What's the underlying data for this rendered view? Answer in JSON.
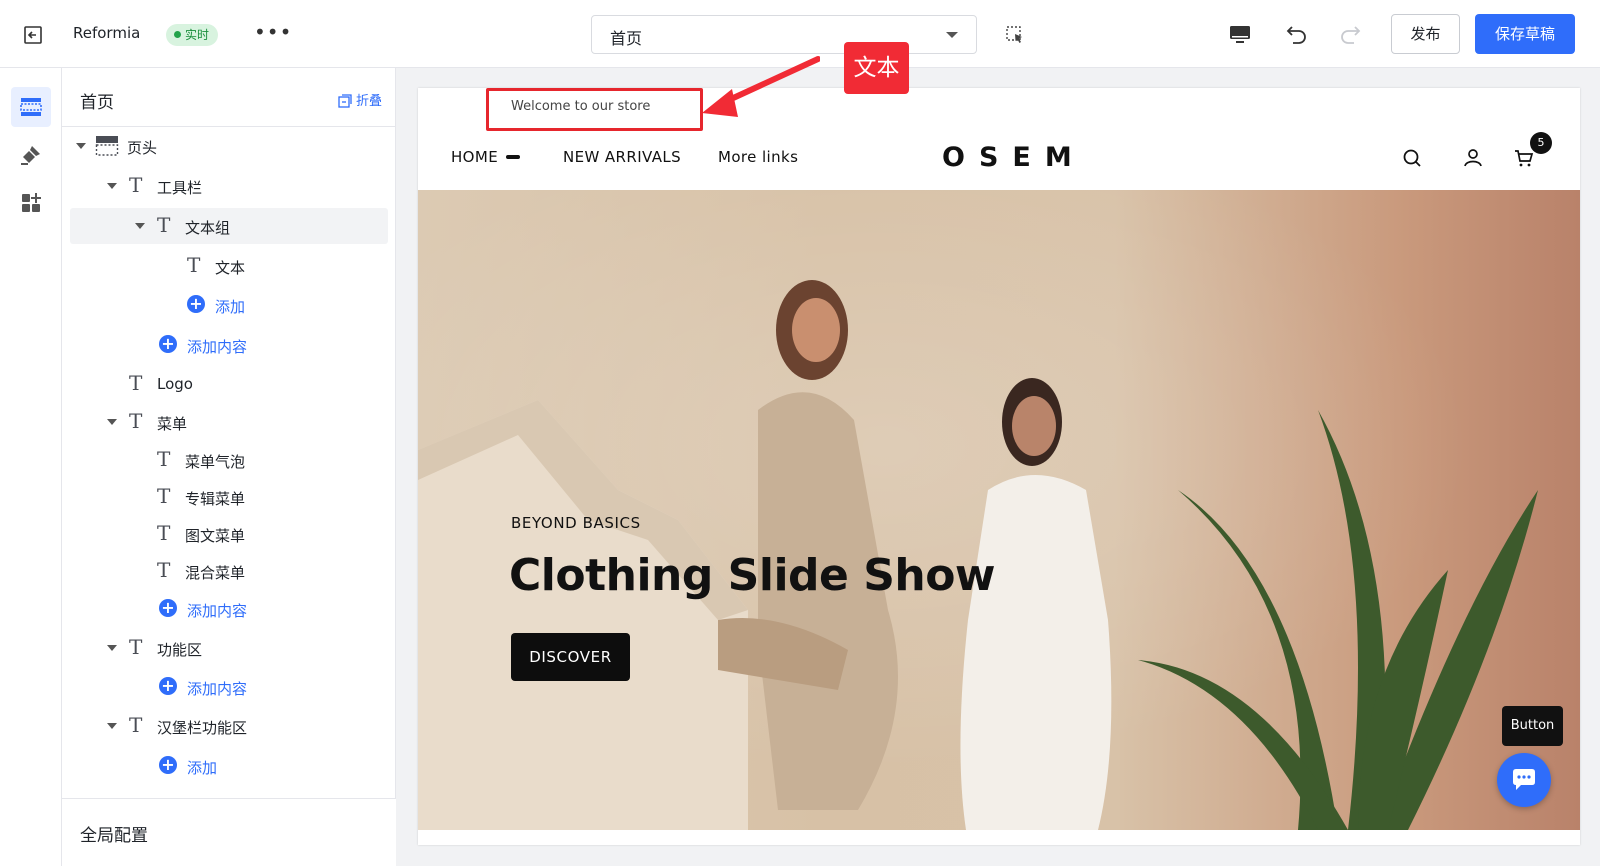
{
  "topbar": {
    "app_name": "Reformia",
    "status_badge": "实时",
    "more": "•••",
    "page_select": "首页",
    "publish_label": "发布",
    "save_draft_label": "保存草稿"
  },
  "rail": {
    "items": [
      "layout-icon",
      "brush-icon",
      "apps-icon"
    ]
  },
  "panel": {
    "title": "首页",
    "collapse_label": "折叠",
    "tree": [
      {
        "label": "页头",
        "kind": "section"
      },
      {
        "label": "工具栏",
        "kind": "text"
      },
      {
        "label": "文本组",
        "kind": "text",
        "selected": true
      },
      {
        "label": "文本",
        "kind": "text"
      },
      {
        "label": "添加",
        "kind": "add"
      },
      {
        "label": "添加内容",
        "kind": "add"
      },
      {
        "label": "Logo",
        "kind": "text"
      },
      {
        "label": "菜单",
        "kind": "text"
      },
      {
        "label": "菜单气泡",
        "kind": "text"
      },
      {
        "label": "专辑菜单",
        "kind": "text"
      },
      {
        "label": "图文菜单",
        "kind": "text"
      },
      {
        "label": "混合菜单",
        "kind": "text"
      },
      {
        "label": "添加内容",
        "kind": "add"
      },
      {
        "label": "功能区",
        "kind": "text"
      },
      {
        "label": "添加内容",
        "kind": "add"
      },
      {
        "label": "汉堡栏功能区",
        "kind": "text"
      },
      {
        "label": "添加",
        "kind": "add"
      }
    ],
    "footer": "全局配置"
  },
  "preview": {
    "announcement": "Welcome to our store",
    "nav_links": [
      "HOME",
      "NEW ARRIVALS",
      "More links"
    ],
    "logo": "OSEM",
    "cart_count": "5",
    "hero": {
      "subtitle": "BEYOND BASICS",
      "title": "Clothing Slide Show",
      "button": "DISCOVER"
    }
  },
  "annotation": {
    "label": "文本",
    "color": "#f12b35"
  },
  "floating": {
    "tooltip": "Button"
  },
  "colors": {
    "accent": "#2f6dfa",
    "live_badge_bg": "#d8f3df",
    "live_badge_text": "#1a8f3c"
  }
}
